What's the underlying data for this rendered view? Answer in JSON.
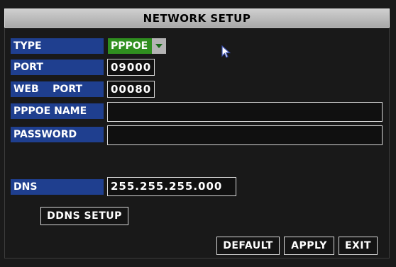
{
  "title": "NETWORK SETUP",
  "fields": {
    "type": {
      "label": "TYPE",
      "value": "PPPOE",
      "icon": "chevron-down-icon"
    },
    "port": {
      "label": "PORT",
      "value": "09000"
    },
    "web_port": {
      "label": "WEB    PORT",
      "value": "00080"
    },
    "pppoe_name": {
      "label": "PPPOE NAME",
      "value": ""
    },
    "password": {
      "label": "PASSWORD",
      "value": ""
    },
    "dns": {
      "label": "DNS",
      "value": "255.255.255.000"
    }
  },
  "buttons": {
    "ddns_setup": "DDNS SETUP",
    "default": "DEFAULT",
    "apply": "APPLY",
    "exit": "EXIT"
  },
  "colors": {
    "label_bg": "#1f3f8f",
    "select_bg": "#2f8f1f",
    "title_bg": "#b9b9b9"
  }
}
